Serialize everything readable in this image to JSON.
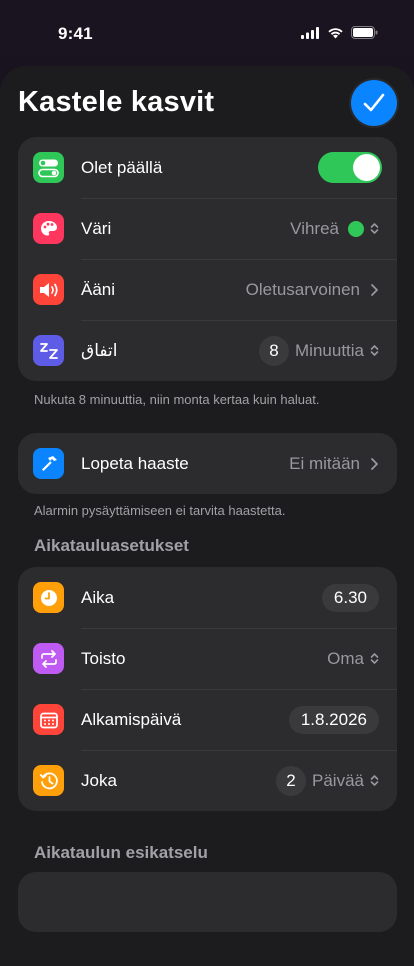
{
  "status_bar": {
    "time": "9:41"
  },
  "header": {
    "title": "Kastele kasvit"
  },
  "group1": {
    "items": [
      {
        "label": "Olet päällä",
        "toggle_on": true
      },
      {
        "label": "Väri",
        "value": "Vihreä",
        "color_dot": "#30c759"
      },
      {
        "label": "Ääni",
        "value": "Oletusarvoinen"
      },
      {
        "label": "اتفاق",
        "badge": "8",
        "value": "Minuuttia"
      }
    ],
    "footnote": "Nukuta 8 minuuttia, niin monta kertaa kuin haluat."
  },
  "group2": {
    "items": [
      {
        "label": "Lopeta haaste",
        "value": "Ei mitään"
      }
    ],
    "footnote": "Alarmin pysäyttämiseen ei tarvita haastetta."
  },
  "schedule": {
    "header": "Aikatauluasetukset",
    "items": [
      {
        "label": "Aika",
        "value": "6.30"
      },
      {
        "label": "Toisto",
        "value": "Oma"
      },
      {
        "label": "Alkamispäivä",
        "value": "1.8.2026"
      },
      {
        "label": "Joka",
        "badge": "2",
        "value": "Päivää"
      }
    ]
  },
  "preview": {
    "header": "Aikataulun esikatselu"
  },
  "colors": {
    "accent": "#0a84ff",
    "green": "#30c759",
    "pink": "#ff375f",
    "red": "#ff453a",
    "indigo": "#5e5ce6",
    "blue": "#0a84ff",
    "orange": "#ff9f0a",
    "purple": "#bf5af2"
  }
}
